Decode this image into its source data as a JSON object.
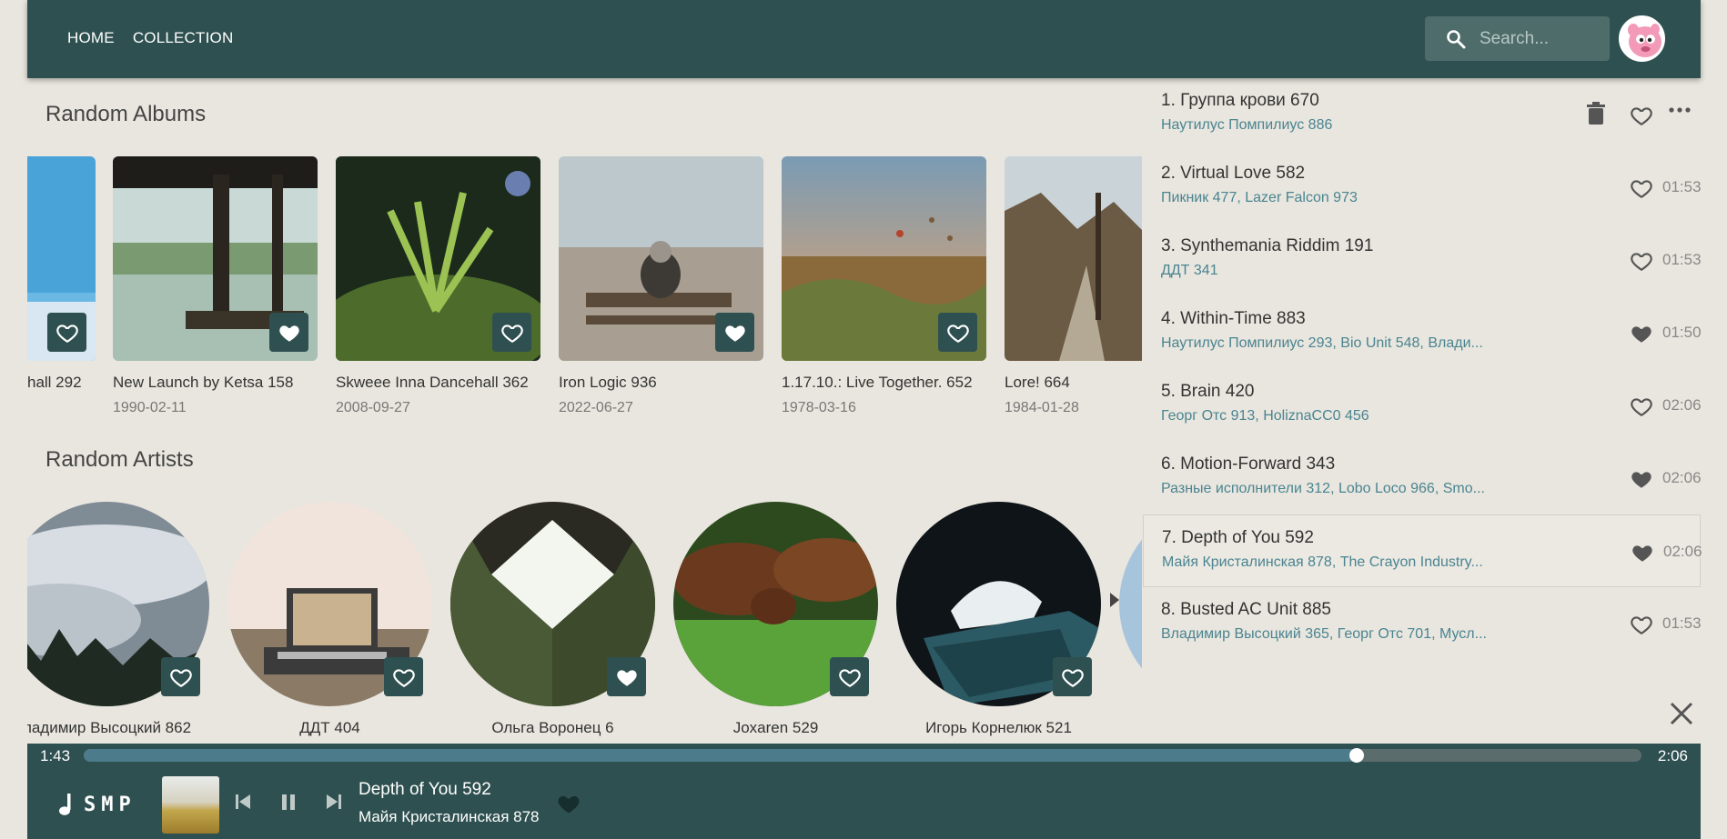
{
  "nav": {
    "home": "HOME",
    "collection": "COLLECTION"
  },
  "search": {
    "placeholder": "Search...",
    "icon": "search-icon"
  },
  "avatar": {
    "icon": "avatar-pink-creature"
  },
  "sections": {
    "albums_title": "Random Albums",
    "artists_title": "Random Artists"
  },
  "albums": [
    {
      "title": "hall 292",
      "date": "",
      "favorite": false
    },
    {
      "title": "New Launch by Ketsa 158",
      "date": "1990-02-11",
      "favorite": true
    },
    {
      "title": "Skweee Inna Dancehall 362",
      "date": "2008-09-27",
      "favorite": false
    },
    {
      "title": "Iron Logic 936",
      "date": "2022-06-27",
      "favorite": true
    },
    {
      "title": "1.17.10.: Live Together. 652",
      "date": "1978-03-16",
      "favorite": false
    },
    {
      "title": "Lore! 664",
      "date": "1984-01-28",
      "favorite": false
    }
  ],
  "artists": [
    {
      "name": "ладимир Высоцкий 862",
      "favorite": false
    },
    {
      "name": "ДДТ 404",
      "favorite": false
    },
    {
      "name": "Ольга Воронец 6",
      "favorite": true
    },
    {
      "name": "Joxaren 529",
      "favorite": false
    },
    {
      "name": "Игорь Корнелюк 521",
      "favorite": false
    }
  ],
  "queue": [
    {
      "title": "1. Группа крови 670",
      "artists": "Наутилус Помпилиус 886",
      "duration": "",
      "favorite": false,
      "hovered_actions": true
    },
    {
      "title": "2. Virtual Love 582",
      "artists": "Пикник 477, Lazer Falcon 973",
      "duration": "01:53",
      "favorite": false
    },
    {
      "title": "3. Synthemania Riddim 191",
      "artists": "ДДТ 341",
      "duration": "01:53",
      "favorite": false
    },
    {
      "title": "4. Within-Time 883",
      "artists": "Наутилус Помпилиус 293, Bio Unit 548, Влади...",
      "duration": "01:50",
      "favorite": true
    },
    {
      "title": "5. Brain 420",
      "artists": "Георг Отс 913, HoliznaCC0 456",
      "duration": "02:06",
      "favorite": false
    },
    {
      "title": "6. Motion-Forward 343",
      "artists": "Разные исполнители 312, Lobo Loco 966, Smo...",
      "duration": "02:06",
      "favorite": true
    },
    {
      "title": "7. Depth of You 592",
      "artists": "Майя Кристалинская 878, The Crayon Industry...",
      "duration": "02:06",
      "favorite": true,
      "active": true
    },
    {
      "title": "8. Busted AC Unit 885",
      "artists": "Владимир Высоцкий 365, Георг Отс 701, Мусл...",
      "duration": "01:53",
      "favorite": false
    }
  ],
  "player": {
    "current_time": "1:43",
    "total_time": "2:06",
    "progress": 0.817,
    "logo_text": "SMP",
    "track_title": "Depth of You 592",
    "track_artist": "Майя Кристалинская 878",
    "favorite": true,
    "state": "playing"
  },
  "colors": {
    "primary": "#2f5050",
    "background": "#e8e6de",
    "accent_link": "#4b8491",
    "progress_fill": "#4c7b8b"
  }
}
